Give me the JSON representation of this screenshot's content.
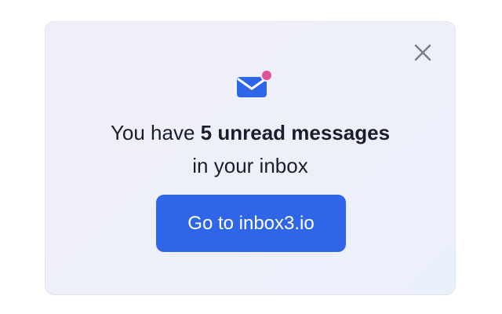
{
  "popup": {
    "message_prefix": "You have",
    "message_bold": "5 unread messages",
    "message_suffix": "in your inbox",
    "button_label": "Go to inbox3.io",
    "close_icon": "close-icon",
    "mail_icon": "mail-icon",
    "notification_dot": "notification-dot"
  },
  "colors": {
    "button": "#2f66e8",
    "mail_icon": "#2f66e8",
    "notification_dot": "#e05497",
    "text": "#1b1d2b",
    "close_icon": "#7a7f8a"
  }
}
